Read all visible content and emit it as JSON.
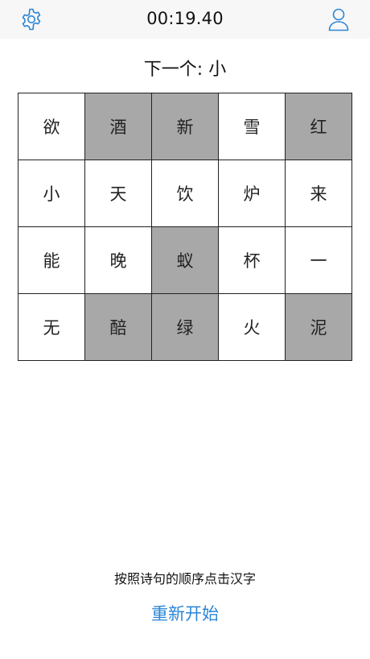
{
  "header": {
    "timer": "00:19.40",
    "settings_icon": "gear-icon",
    "profile_icon": "user-icon",
    "accent_color": "#2a86d6"
  },
  "prompt": {
    "label": "下一个: ",
    "next_char": "小"
  },
  "grid": {
    "rows": 4,
    "cols": 5,
    "cells": [
      {
        "char": "欲",
        "selected": false
      },
      {
        "char": "酒",
        "selected": true
      },
      {
        "char": "新",
        "selected": true
      },
      {
        "char": "雪",
        "selected": false
      },
      {
        "char": "红",
        "selected": true
      },
      {
        "char": "小",
        "selected": false
      },
      {
        "char": "天",
        "selected": false
      },
      {
        "char": "饮",
        "selected": false
      },
      {
        "char": "炉",
        "selected": false
      },
      {
        "char": "来",
        "selected": false
      },
      {
        "char": "能",
        "selected": false
      },
      {
        "char": "晚",
        "selected": false
      },
      {
        "char": "蚁",
        "selected": true
      },
      {
        "char": "杯",
        "selected": false
      },
      {
        "char": "一",
        "selected": false
      },
      {
        "char": "无",
        "selected": false
      },
      {
        "char": "醅",
        "selected": true
      },
      {
        "char": "绿",
        "selected": true
      },
      {
        "char": "火",
        "selected": false
      },
      {
        "char": "泥",
        "selected": true
      }
    ],
    "selected_color": "#a8a8a8"
  },
  "footer": {
    "instruction": "按照诗句的顺序点击汉字",
    "restart_label": "重新开始"
  }
}
